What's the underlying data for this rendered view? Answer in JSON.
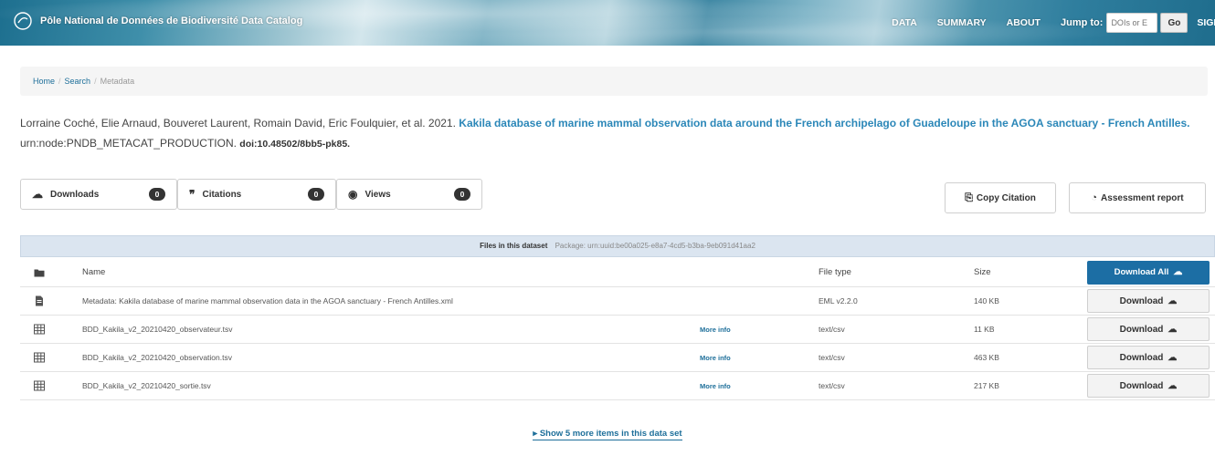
{
  "header": {
    "site_title": "Pôle National de Données de Biodiversité Data Catalog",
    "nav": [
      "DATA",
      "SUMMARY",
      "ABOUT"
    ],
    "jump_label": "Jump to:",
    "jump_placeholder": "DOIs or E",
    "go_label": "Go",
    "sign_in_label": "SIGN"
  },
  "breadcrumb": {
    "home": "Home",
    "search": "Search",
    "current": "Metadata",
    "separator": "/"
  },
  "citation": {
    "authors": "Lorraine Coché, Elie Arnaud, Bouveret Laurent, Romain David, Eric Foulquier, et al. 2021.",
    "title": "Kakila database of marine mammal observation data around the French archipelago of Guadeloupe in the AGOA sanctuary - French Antilles.",
    "node": "urn:node:PNDB_METACAT_PRODUCTION.",
    "doi": "doi:10.48502/8bb5-pk85."
  },
  "metrics": {
    "downloads_label": "Downloads",
    "downloads_count": "0",
    "citations_label": "Citations",
    "citations_count": "0",
    "views_label": "Views",
    "views_count": "0",
    "copy_citation_label": "Copy Citation",
    "assessment_label": "Assessment report"
  },
  "files": {
    "header_title": "Files in this dataset",
    "package_label": "Package: urn:uuid:be00a025-e8a7-4cd5-b3ba-9eb091d41aa2",
    "columns": {
      "name": "Name",
      "file_type": "File type",
      "size": "Size",
      "download_all": "Download All"
    },
    "rows": [
      {
        "icon": "metadata-file-icon",
        "name": "Metadata: Kakila database of marine mammal observation data in the AGOA sanctuary - French Antilles.xml",
        "more_info": "",
        "type": "EML v2.2.0",
        "size": "140 KB",
        "download": "Download"
      },
      {
        "icon": "table-icon",
        "name": "BDD_Kakila_v2_20210420_observateur.tsv",
        "more_info": "More info",
        "type": "text/csv",
        "size": "11 KB",
        "download": "Download"
      },
      {
        "icon": "table-icon",
        "name": "BDD_Kakila_v2_20210420_observation.tsv",
        "more_info": "More info",
        "type": "text/csv",
        "size": "463 KB",
        "download": "Download"
      },
      {
        "icon": "table-icon",
        "name": "BDD_Kakila_v2_20210420_sortie.tsv",
        "more_info": "More info",
        "type": "text/csv",
        "size": "217 KB",
        "download": "Download"
      }
    ],
    "show_more": "Show 5 more items in this data set"
  },
  "colors": {
    "link": "#1e6f9a",
    "title_link": "#2b87b8",
    "primary_button": "#1c6ea4",
    "files_header_bg": "#dbe5f0"
  }
}
